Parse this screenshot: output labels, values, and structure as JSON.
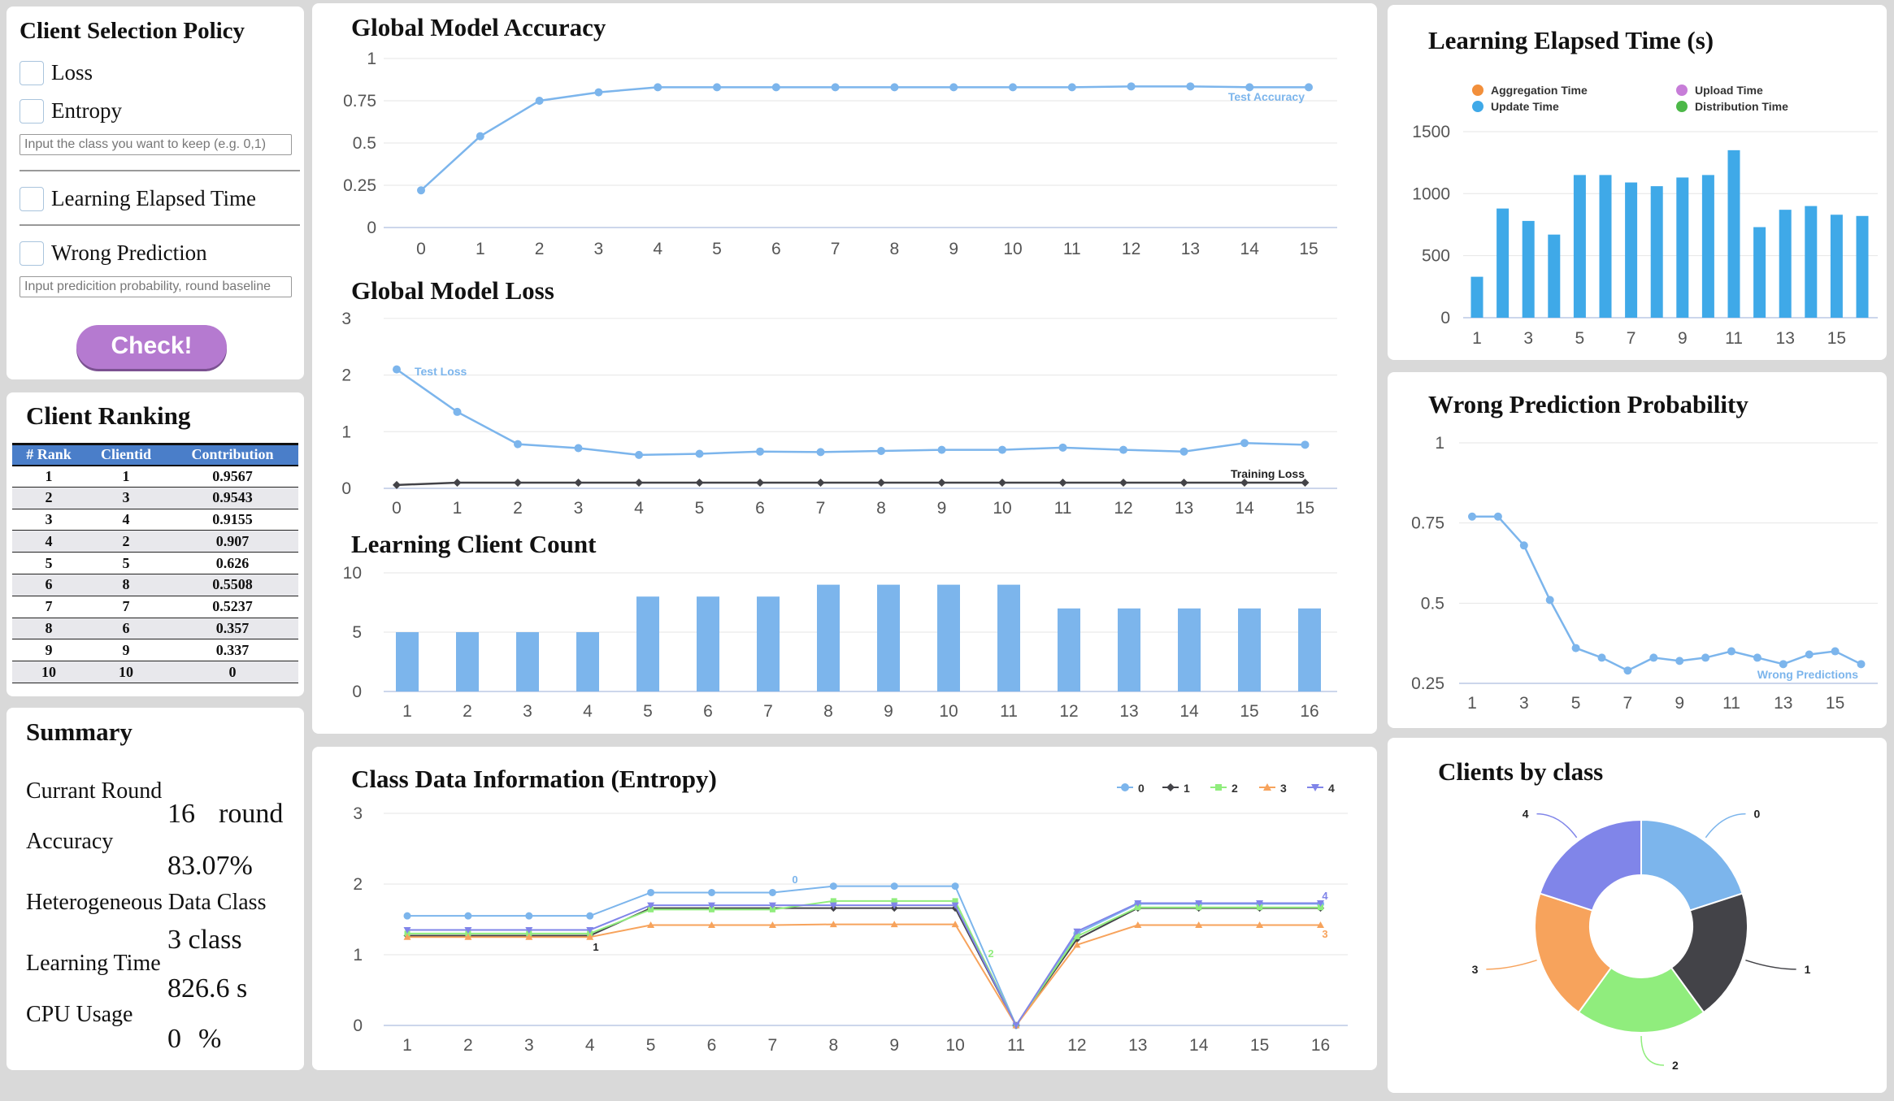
{
  "policy": {
    "title": "Client Selection Policy",
    "loss_label": "Loss",
    "entropy_label": "Entropy",
    "class_input_placeholder": "Input the class you want to keep (e.g. 0,1)",
    "elapsed_label": "Learning Elapsed Time",
    "wrong_label": "Wrong Prediction",
    "wrong_input_placeholder": "Input predicition probability, round baseline",
    "check_label": "Check!"
  },
  "ranking": {
    "title": "Client Ranking",
    "headers": [
      "# Rank",
      "Clientid",
      "Contribution"
    ],
    "rows": [
      [
        "1",
        "1",
        "0.9567"
      ],
      [
        "2",
        "3",
        "0.9543"
      ],
      [
        "3",
        "4",
        "0.9155"
      ],
      [
        "4",
        "2",
        "0.907"
      ],
      [
        "5",
        "5",
        "0.626"
      ],
      [
        "6",
        "8",
        "0.5508"
      ],
      [
        "7",
        "7",
        "0.5237"
      ],
      [
        "8",
        "6",
        "0.357"
      ],
      [
        "9",
        "9",
        "0.337"
      ],
      [
        "10",
        "10",
        "0"
      ]
    ]
  },
  "summary": {
    "title": "Summary",
    "round_label": "Currant Round",
    "round_value": "16",
    "round_unit": "round",
    "accuracy_label": "Accuracy",
    "accuracy_value": "83.07%",
    "hetero_label": "Heterogeneous Data Class",
    "hetero_value": "3 class",
    "time_label": "Learning Time",
    "time_value": "826.6 s",
    "cpu_label": "CPU Usage",
    "cpu_value": "0",
    "cpu_unit": "%"
  },
  "charts": {
    "accuracy_title": "Global Model Accuracy",
    "loss_title": "Global Model Loss",
    "count_title": "Learning Client Count",
    "entropy_title": "Class Data Information (Entropy)",
    "elapsed_title": "Learning Elapsed Time (s)",
    "wrong_title": "Wrong Prediction Probability",
    "clients_title": "Clients by class"
  },
  "colors": {
    "blue": "#7cb5ec",
    "dark": "#434348",
    "green": "#90ed7d",
    "orange": "#f7a35c",
    "purple": "#8085e9",
    "bar_blue": "#3fa9e8",
    "agg": "#f28f3b",
    "upload": "#c77dd8",
    "dist": "#4cb848",
    "check": "#b57ad0"
  },
  "chart_data": [
    {
      "id": "accuracy",
      "type": "line",
      "title": "Global Model Accuracy",
      "x": [
        0,
        1,
        2,
        3,
        4,
        5,
        6,
        7,
        8,
        9,
        10,
        11,
        12,
        13,
        14,
        15
      ],
      "yticks": [
        "0",
        "0.25",
        "0.5",
        "0.75",
        "1"
      ],
      "ylim": [
        0,
        1
      ],
      "series": [
        {
          "name": "Test Accuracy",
          "values": [
            0.22,
            0.54,
            0.75,
            0.8,
            0.83,
            0.83,
            0.83,
            0.83,
            0.83,
            0.83,
            0.83,
            0.83,
            0.835,
            0.835,
            0.83,
            0.83
          ]
        }
      ]
    },
    {
      "id": "loss",
      "type": "line",
      "title": "Global Model Loss",
      "x": [
        0,
        1,
        2,
        3,
        4,
        5,
        6,
        7,
        8,
        9,
        10,
        11,
        12,
        13,
        14,
        15
      ],
      "yticks": [
        "0",
        "1",
        "2",
        "3"
      ],
      "ylim": [
        0,
        3
      ],
      "series": [
        {
          "name": "Test Loss",
          "values": [
            2.1,
            1.35,
            0.78,
            0.71,
            0.59,
            0.61,
            0.65,
            0.64,
            0.66,
            0.68,
            0.68,
            0.72,
            0.68,
            0.65,
            0.8,
            0.77
          ]
        },
        {
          "name": "Training Loss",
          "values": [
            0.06,
            0.1,
            0.1,
            0.1,
            0.1,
            0.1,
            0.1,
            0.1,
            0.1,
            0.1,
            0.1,
            0.1,
            0.1,
            0.1,
            0.1,
            0.1
          ]
        }
      ]
    },
    {
      "id": "count",
      "type": "bar",
      "title": "Learning Client Count",
      "categories": [
        "1",
        "2",
        "3",
        "4",
        "5",
        "6",
        "7",
        "8",
        "9",
        "10",
        "11",
        "12",
        "13",
        "14",
        "15",
        "16"
      ],
      "values": [
        5,
        5,
        5,
        5,
        8,
        8,
        8,
        9,
        9,
        9,
        9,
        7,
        7,
        7,
        7,
        7
      ],
      "yticks": [
        "0",
        "5",
        "10"
      ],
      "ylim": [
        0,
        10
      ]
    },
    {
      "id": "entropy",
      "type": "line",
      "title": "Class Data Information (Entropy)",
      "x": [
        1,
        2,
        3,
        4,
        5,
        6,
        7,
        8,
        9,
        10,
        11,
        12,
        13,
        14,
        15,
        16
      ],
      "yticks": [
        "0",
        "1",
        "2",
        "3"
      ],
      "ylim": [
        0,
        3
      ],
      "series": [
        {
          "name": "0",
          "values": [
            1.55,
            1.55,
            1.55,
            1.55,
            1.88,
            1.88,
            1.88,
            1.97,
            1.97,
            1.97,
            0,
            1.3,
            1.72,
            1.72,
            1.72,
            1.72
          ]
        },
        {
          "name": "1",
          "values": [
            1.27,
            1.27,
            1.27,
            1.27,
            1.66,
            1.66,
            1.66,
            1.66,
            1.66,
            1.66,
            0,
            1.22,
            1.66,
            1.66,
            1.66,
            1.66
          ]
        },
        {
          "name": "2",
          "values": [
            1.3,
            1.3,
            1.3,
            1.3,
            1.64,
            1.64,
            1.64,
            1.76,
            1.76,
            1.76,
            0,
            1.26,
            1.67,
            1.67,
            1.67,
            1.67
          ]
        },
        {
          "name": "3",
          "values": [
            1.25,
            1.25,
            1.25,
            1.25,
            1.42,
            1.42,
            1.42,
            1.43,
            1.43,
            1.43,
            0,
            1.14,
            1.42,
            1.42,
            1.42,
            1.42
          ]
        },
        {
          "name": "4",
          "values": [
            1.35,
            1.35,
            1.35,
            1.35,
            1.7,
            1.7,
            1.7,
            1.7,
            1.7,
            1.7,
            0,
            1.33,
            1.73,
            1.73,
            1.73,
            1.73
          ]
        }
      ]
    },
    {
      "id": "elapsed",
      "type": "bar",
      "title": "Learning Elapsed Time (s)",
      "categories": [
        "1",
        "2",
        "3",
        "4",
        "5",
        "6",
        "7",
        "8",
        "9",
        "10",
        "11",
        "12",
        "13",
        "14",
        "15",
        "16"
      ],
      "xticks": [
        "1",
        "3",
        "5",
        "7",
        "9",
        "11",
        "13",
        "15"
      ],
      "legend": [
        "Aggregation Time",
        "Upload Time",
        "Update Time",
        "Distribution Time"
      ],
      "series": [
        {
          "name": "Update Time",
          "values": [
            330,
            880,
            780,
            670,
            1150,
            1150,
            1090,
            1060,
            1130,
            1150,
            1350,
            730,
            870,
            900,
            830,
            820
          ]
        }
      ],
      "yticks": [
        "0",
        "500",
        "1000",
        "1500"
      ],
      "ylim": [
        0,
        1500
      ]
    },
    {
      "id": "wrong",
      "type": "line",
      "title": "Wrong Prediction Probability",
      "x": [
        1,
        2,
        3,
        4,
        5,
        6,
        7,
        8,
        9,
        10,
        11,
        12,
        13,
        14,
        15,
        16
      ],
      "xticks": [
        "1",
        "3",
        "5",
        "7",
        "9",
        "11",
        "13",
        "15"
      ],
      "yticks": [
        "0.25",
        "0.5",
        "0.75",
        "1"
      ],
      "ylim": [
        0.25,
        1
      ],
      "series": [
        {
          "name": "Wrong Predictions",
          "values": [
            0.77,
            0.77,
            0.68,
            0.51,
            0.36,
            0.33,
            0.29,
            0.33,
            0.32,
            0.33,
            0.35,
            0.33,
            0.31,
            0.34,
            0.35,
            0.31
          ]
        }
      ]
    },
    {
      "id": "clients",
      "type": "pie",
      "title": "Clients by class",
      "categories": [
        "0",
        "1",
        "2",
        "3",
        "4"
      ],
      "values": [
        20,
        20,
        20,
        20,
        20
      ]
    }
  ]
}
